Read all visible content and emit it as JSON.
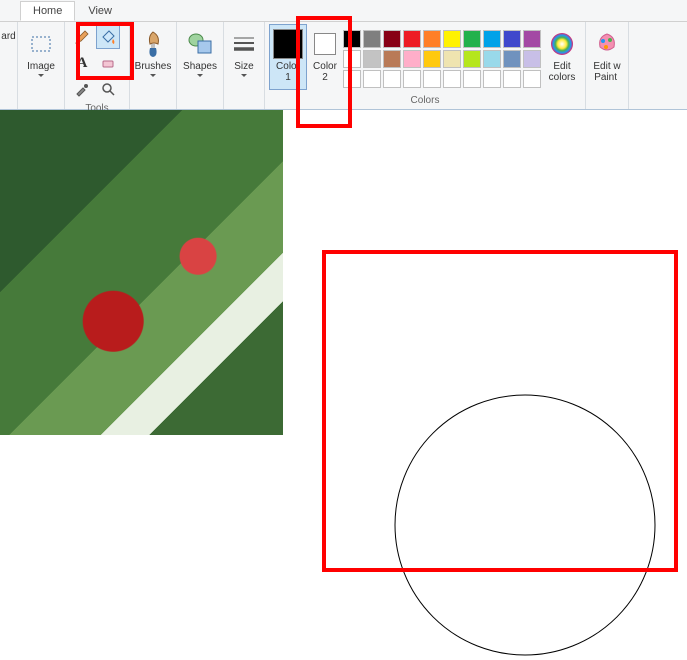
{
  "tabs": {
    "home": "Home",
    "view": "View"
  },
  "groups": {
    "clipboard": {
      "ard": "ard"
    },
    "image": {
      "label": "Image"
    },
    "tools": {
      "label": "Tools"
    },
    "brushes": {
      "label": "Brushes"
    },
    "shapes": {
      "label": "Shapes"
    },
    "size": {
      "label": "Size"
    },
    "color1": {
      "label": "Color\n1"
    },
    "color2": {
      "label": "Color\n2"
    },
    "colors_group": {
      "label": "Colors"
    },
    "edit_colors": {
      "label": "Edit\ncolors"
    },
    "edit_paint3d": {
      "label": "Edit w\nPaint "
    }
  },
  "colors": {
    "selected": "#000000",
    "secondary": "#ffffff",
    "palette_row1": [
      "#000000",
      "#7f7f7f",
      "#880015",
      "#ed1c24",
      "#ff7f27",
      "#fff200",
      "#22b14c",
      "#00a2e8",
      "#3f48cc",
      "#a349a4"
    ],
    "palette_row2": [
      "#ffffff",
      "#c3c3c3",
      "#b97a57",
      "#ffaec9",
      "#ffc90e",
      "#efe4b0",
      "#b5e61d",
      "#99d9ea",
      "#7092be",
      "#c8bfe7"
    ],
    "palette_row3": [
      "#ffffff",
      "#ffffff",
      "#ffffff",
      "#ffffff",
      "#ffffff",
      "#ffffff",
      "#ffffff",
      "#ffffff",
      "#ffffff",
      "#ffffff"
    ]
  }
}
